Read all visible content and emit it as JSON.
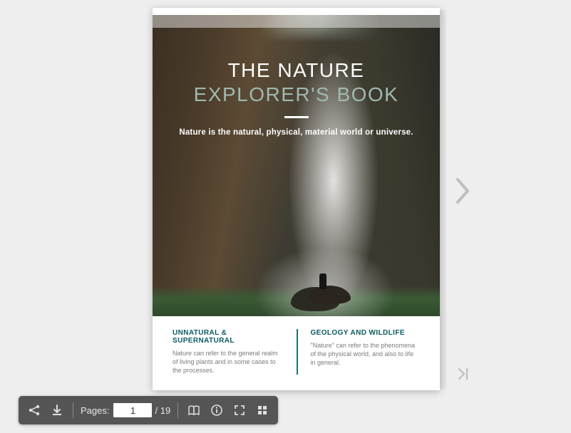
{
  "cover": {
    "title_line1": "THE NATURE",
    "title_line2": "EXPLORER'S BOOK",
    "subtitle": "Nature is the natural, physical, material world or universe.",
    "columns": [
      {
        "heading": "UNNATURAL & SUPERNATURAL",
        "body": "Nature can refer to the general realm of living plants and in some cases to the processes."
      },
      {
        "heading": "GEOLOGY AND WILDLIFE",
        "body": "\"Nature\" can refer to the phenomena of the physical world, and also to life in general."
      }
    ]
  },
  "nav": {
    "next_icon": "chevron-right-icon",
    "last_icon": "last-page-icon"
  },
  "toolbar": {
    "share_icon": "share-icon",
    "download_icon": "download-icon",
    "pages_label": "Pages:",
    "current_page": "1",
    "page_total": "/ 19",
    "book_icon": "book-open-icon",
    "info_icon": "info-icon",
    "fullscreen_icon": "fullscreen-icon",
    "grid_icon": "grid-icon"
  }
}
